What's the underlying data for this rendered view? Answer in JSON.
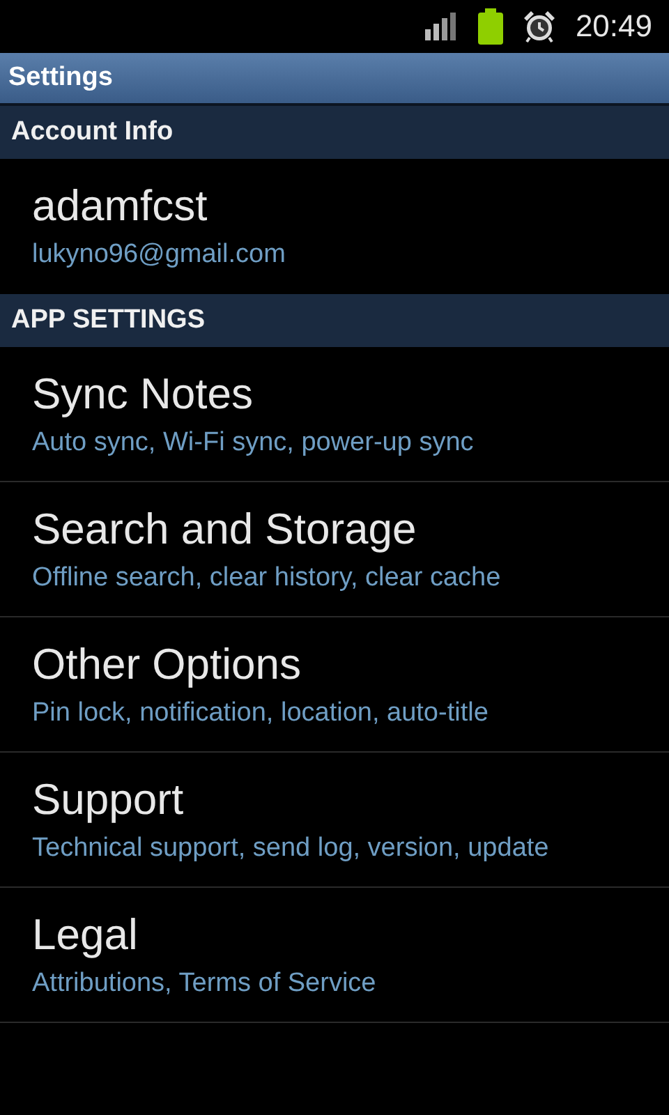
{
  "status_bar": {
    "time": "20:49"
  },
  "title_bar": {
    "title": "Settings"
  },
  "sections": [
    {
      "header": "Account Info",
      "items": [
        {
          "title": "adamfcst",
          "subtitle": "lukyno96@gmail.com"
        }
      ]
    },
    {
      "header": "APP SETTINGS",
      "items": [
        {
          "title": "Sync Notes",
          "subtitle": "Auto sync, Wi-Fi sync, power-up sync"
        },
        {
          "title": "Search and Storage",
          "subtitle": "Offline search, clear history, clear cache"
        },
        {
          "title": "Other Options",
          "subtitle": "Pin lock, notification, location, auto-title"
        },
        {
          "title": "Support",
          "subtitle": "Technical support, send log, version, update"
        },
        {
          "title": "Legal",
          "subtitle": "Attributions, Terms of Service"
        }
      ]
    }
  ]
}
